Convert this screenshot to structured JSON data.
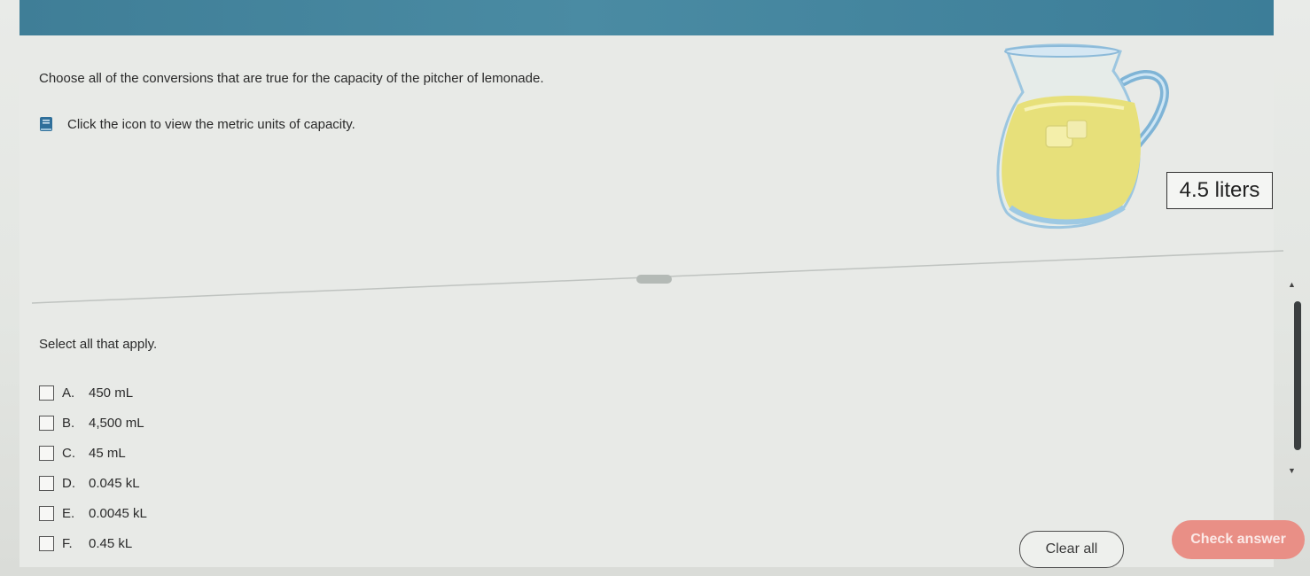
{
  "question": {
    "prompt": "Choose all of the conversions that are true for the capacity of the pitcher of lemonade.",
    "hint_text": "Click the icon to view the metric units of capacity.",
    "capacity_label": "4.5 liters"
  },
  "answer_section": {
    "instruction": "Select all that apply.",
    "options": [
      {
        "letter": "A.",
        "text": "450 mL",
        "checked": false
      },
      {
        "letter": "B.",
        "text": "4,500 mL",
        "checked": false
      },
      {
        "letter": "C.",
        "text": "45 mL",
        "checked": false
      },
      {
        "letter": "D.",
        "text": "0.045 kL",
        "checked": false
      },
      {
        "letter": "E.",
        "text": "0.0045 kL",
        "checked": false
      },
      {
        "letter": "F.",
        "text": "0.45 kL",
        "checked": false
      }
    ]
  },
  "buttons": {
    "clear_all": "Clear all",
    "check_answer": "Check answer"
  },
  "icons": {
    "hint": "book-icon",
    "scroll_up": "triangle-up-icon",
    "scroll_down": "triangle-down-icon"
  },
  "colors": {
    "header": "#4a8ba3",
    "check_answer_button": "#e98f86",
    "lemonade": "#e8e07a"
  }
}
